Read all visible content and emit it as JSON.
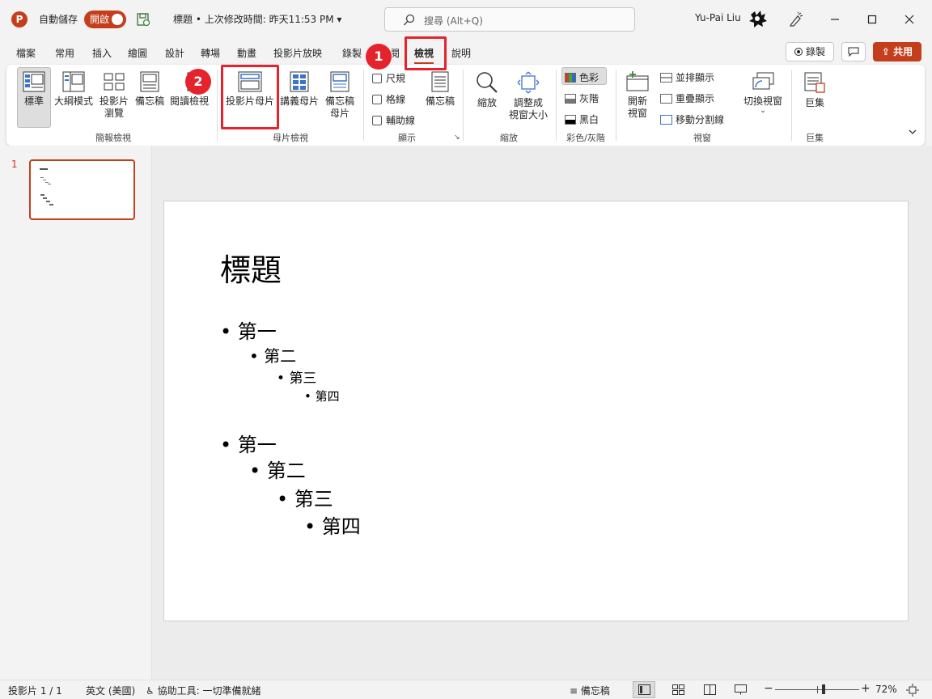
{
  "titlebar": {
    "app_icon": "P",
    "autosave_label": "自動儲存",
    "autosave_state": "開啟",
    "doc_title": "標題 • 上次修改時間: 昨天11:53 PM",
    "search_placeholder": "搜尋 (Alt+Q)",
    "user_name": "Yu-Pai Liu"
  },
  "menu": {
    "tabs": [
      "檔案",
      "常用",
      "插入",
      "繪圖",
      "設計",
      "轉場",
      "動畫",
      "投影片放映",
      "錄製",
      "校閱",
      "檢視",
      "說明"
    ],
    "active_tab": "檢視",
    "record_label": "錄製",
    "share_label": "共用"
  },
  "ribbon": {
    "presentation_views": {
      "label": "簡報檢視",
      "normal": "標準",
      "outline": "大綱模式",
      "sorter": [
        "投影片",
        "瀏覽"
      ],
      "notes_page": "備忘稿",
      "reading": "閱讀檢視"
    },
    "master_views": {
      "label": "母片檢視",
      "slide_master": "投影片母片",
      "handout_master": "講義母片",
      "notes_master": [
        "備忘稿",
        "母片"
      ]
    },
    "show": {
      "label": "顯示",
      "ruler": "尺規",
      "gridlines": "格線",
      "guides": "輔助線",
      "notes": "備忘稿"
    },
    "zoom": {
      "label": "縮放",
      "zoom": "縮放",
      "fit": [
        "調整成",
        "視窗大小"
      ]
    },
    "color": {
      "label": "彩色/灰階",
      "color": "色彩",
      "grayscale": "灰階",
      "bw": "黑白"
    },
    "window": {
      "label": "視窗",
      "new_window": [
        "開新",
        "視窗"
      ],
      "arrange_all": "並排顯示",
      "cascade": "重疊顯示",
      "move_split": "移動分割線",
      "switch_windows": "切換視窗"
    },
    "macros": {
      "label": "巨集",
      "macros": "巨集"
    }
  },
  "annotations": {
    "step1": "1",
    "step2": "2"
  },
  "slide_panel": {
    "slide_number": "1"
  },
  "slide": {
    "title": "標題",
    "bullets_a": [
      "第一",
      "第二",
      "第三",
      "第四"
    ],
    "bullets_b": [
      "第一",
      "第二",
      "第三",
      "第四"
    ]
  },
  "statusbar": {
    "slide_info": "投影片 1 / 1",
    "language": "英文 (美國)",
    "accessibility": "協助工具: 一切準備就緒",
    "notes": "備忘稿",
    "zoom_value": "72%",
    "zoom_fraction": 0.58
  },
  "colors": {
    "accent": "#c43e1c",
    "highlight": "#e4232d"
  }
}
